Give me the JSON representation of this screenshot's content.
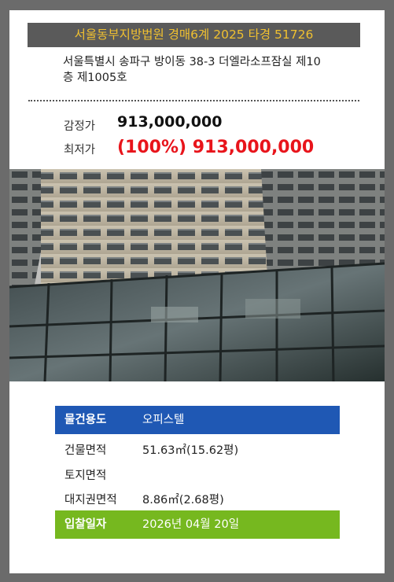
{
  "header": {
    "title": "서울동부지방법원 경매6계 2025 타경 51726"
  },
  "address": {
    "line1": "서울특별시 송파구 방이동 38-3 더엘라소프잠실 제10",
    "line2": "층 제1005호"
  },
  "prices": {
    "appraised_label": "감정가",
    "appraised_value": "913,000,000",
    "minimum_label": "최저가",
    "minimum_value": "(100%) 913,000,000"
  },
  "photo": {
    "subject": "office-building-facade"
  },
  "details": {
    "property_type_label": "물건용도",
    "property_type_value": "오피스텔",
    "building_area_label": "건물면적",
    "building_area_value": "51.63㎡(15.62평)",
    "land_area_label": "토지면적",
    "land_area_value": "",
    "land_right_area_label": "대지권면적",
    "land_right_area_value": "8.86㎡(2.68평)",
    "bid_date_label": "입찰일자",
    "bid_date_value": "2026년 04월 20일"
  },
  "colors": {
    "frame": "#6b6b6b",
    "header_bg": "#5a5a5a",
    "header_text": "#f0c030",
    "min_price": "#e8141b",
    "type_row": "#1f58b4",
    "bid_row": "#76b81f"
  }
}
